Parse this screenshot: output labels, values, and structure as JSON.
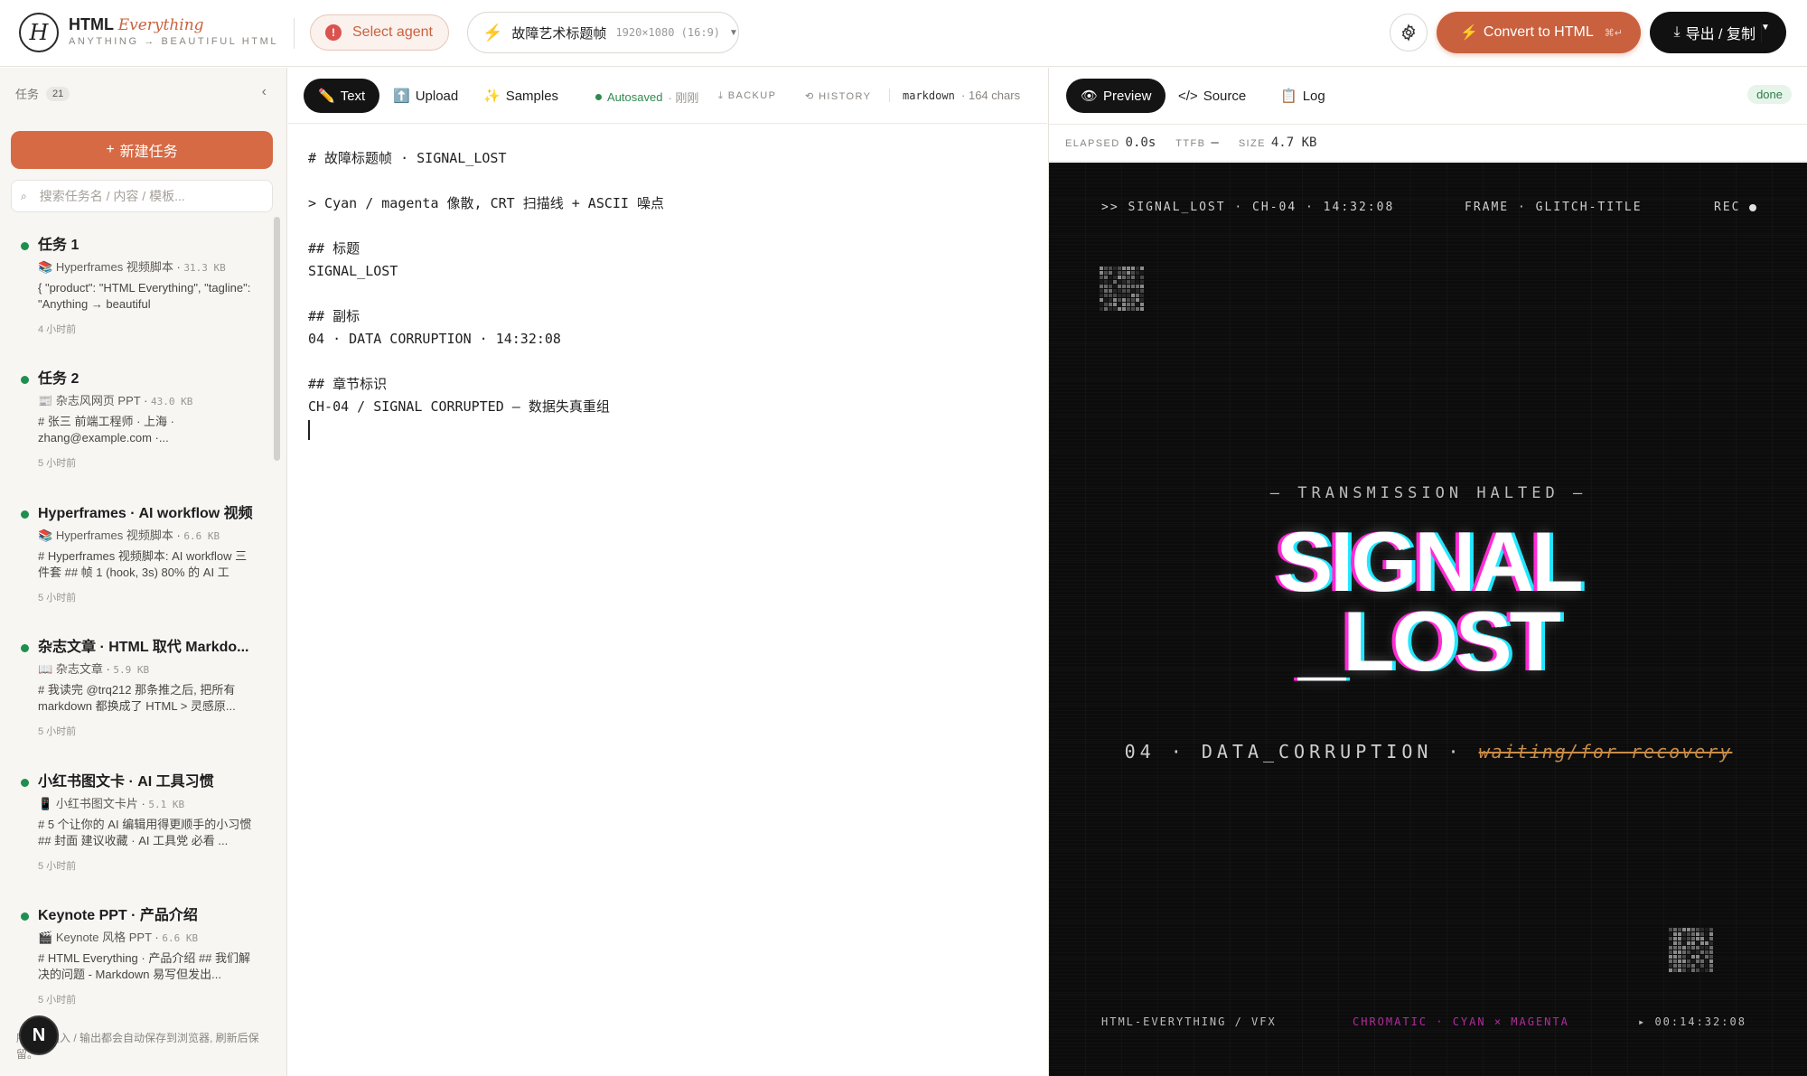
{
  "header": {
    "logo_letter": "H",
    "brand_strong": "HTML",
    "brand_italic": "Everything",
    "tagline": "ANYTHING → BEAUTIFUL HTML",
    "agent_label": "Select agent",
    "agent_alert": "!",
    "template_name": "故障艺术标题帧",
    "template_size": "1920×1080 (16:9)",
    "convert_label": "Convert to HTML",
    "convert_shortcut": "⌘↵",
    "export_label": "导出 / 复制"
  },
  "sidebar": {
    "title": "任务",
    "count": "21",
    "new_task_label": "新建任务",
    "search_placeholder": "搜索任务名 / 内容 / 模板...",
    "tasks": [
      {
        "title": "任务 1",
        "icon": "📚",
        "template": "Hyperframes 视频脚本",
        "size": "31.3 KB",
        "preview": "{ \"product\": \"HTML Everything\", \"tagline\": \"Anything → beautiful",
        "time": "4 小时前"
      },
      {
        "title": "任务 2",
        "icon": "📰",
        "template": "杂志风网页 PPT",
        "size": "43.0 KB",
        "preview": "# 张三 前端工程师 · 上海 · zhang@example.com ·...",
        "time": "5 小时前"
      },
      {
        "title": "Hyperframes · AI workflow 视频",
        "icon": "📚",
        "template": "Hyperframes 视频脚本",
        "size": "6.6 KB",
        "preview": "# Hyperframes 视频脚本: AI workflow 三件套 ## 帧 1 (hook, 3s) 80% 的 AI 工",
        "time": "5 小时前"
      },
      {
        "title": "杂志文章 · HTML 取代 Markdo...",
        "icon": "📖",
        "template": "杂志文章",
        "size": "5.9 KB",
        "preview": "# 我读完 @trq212 那条推之后, 把所有 markdown 都换成了 HTML > 灵感原...",
        "time": "5 小时前"
      },
      {
        "title": "小红书图文卡 · AI 工具习惯",
        "icon": "📱",
        "template": "小红书图文卡片",
        "size": "5.1 KB",
        "preview": "# 5 个让你的 AI 编辑用得更顺手的小习惯 ## 封面 建议收藏 · AI 工具党 必看 ...",
        "time": "5 小时前"
      },
      {
        "title": "Keynote PPT · 产品介绍",
        "icon": "🎬",
        "template": "Keynote 风格 PPT",
        "size": "6.6 KB",
        "preview": "# HTML Everything · 产品介绍 ## 我们解决的问题 - Markdown 易写但发出...",
        "time": "5 小时前"
      }
    ],
    "footer_note": "所有的输入 / 输出都会自动保存到浏览器, 刷新后保留。",
    "avatar_letter": "N"
  },
  "editor": {
    "tabs": [
      {
        "icon": "✏️",
        "label": "Text"
      },
      {
        "icon": "⬆️",
        "label": "Upload"
      },
      {
        "icon": "✨",
        "label": "Samples"
      }
    ],
    "autosave_label": "Autosaved",
    "autosave_when": "· 刚刚",
    "backup_label": "⤓ BACKUP",
    "history_label": "⟲ HISTORY",
    "format": "markdown",
    "chars": "· 164 chars",
    "content": "# 故障标题帧 · SIGNAL_LOST\n\n> Cyan / magenta 像散, CRT 扫描线 + ASCII 噪点\n\n## 标题\nSIGNAL_LOST\n\n## 副标\n04 · DATA CORRUPTION · 14:32:08\n\n## 章节标识\nCH-04 / SIGNAL CORRUPTED — 数据失真重组\n"
  },
  "preview": {
    "tabs": [
      {
        "icon": "👁",
        "label": "Preview"
      },
      {
        "icon": "</>",
        "label": "Source"
      },
      {
        "icon": "📋",
        "label": "Log"
      }
    ],
    "status": "done",
    "elapsed_label": "ELAPSED",
    "elapsed_value": "0.0s",
    "ttfb_label": "TTFB",
    "ttfb_value": "—",
    "size_label": "SIZE",
    "size_value": "4.7 KB",
    "frame": {
      "top_left": ">> SIGNAL_LOST · CH-04 · 14:32:08",
      "top_center": "FRAME · GLITCH-TITLE",
      "top_right": "REC",
      "kicker": "— TRANSMISSION HALTED —",
      "title_line1": "SIGNAL",
      "title_line2": "_LOST",
      "subtitle_main": "04 · DATA_CORRUPTION · ",
      "subtitle_wait": "waiting/for-recovery",
      "bottom_left": "HTML-EVERYTHING / VFX",
      "bottom_center": "CHROMATIC · CYAN × MAGENTA",
      "bottom_right": "▸ 00:14:32:08"
    }
  },
  "colors": {
    "accent": "#c9613f",
    "success": "#1f8f4f",
    "glitch_cyan": "#22e7ff",
    "glitch_magenta": "#ff2bd6"
  }
}
